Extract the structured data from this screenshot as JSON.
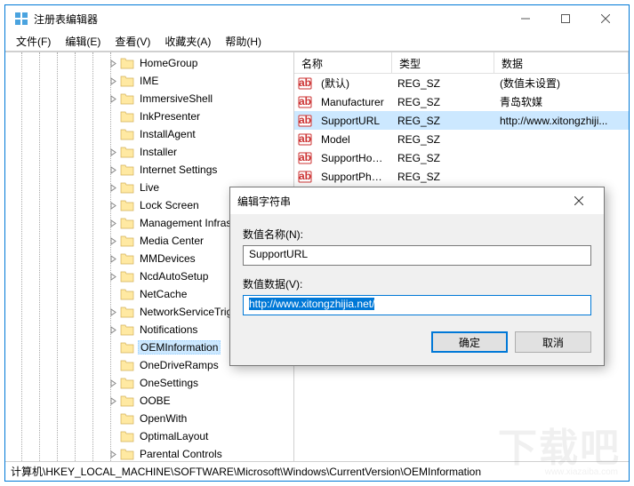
{
  "window": {
    "title": "注册表编辑器"
  },
  "menu": {
    "file": "文件(F)",
    "edit": "编辑(E)",
    "view": "查看(V)",
    "favorites": "收藏夹(A)",
    "help": "帮助(H)"
  },
  "tree": {
    "items": [
      {
        "label": "HomeGroup",
        "expandable": true
      },
      {
        "label": "IME",
        "expandable": true
      },
      {
        "label": "ImmersiveShell",
        "expandable": true
      },
      {
        "label": "InkPresenter",
        "expandable": false
      },
      {
        "label": "InstallAgent",
        "expandable": false
      },
      {
        "label": "Installer",
        "expandable": true
      },
      {
        "label": "Internet Settings",
        "expandable": true
      },
      {
        "label": "Live",
        "expandable": true
      },
      {
        "label": "Lock Screen",
        "expandable": true
      },
      {
        "label": "Management Infrastructure",
        "expandable": true
      },
      {
        "label": "Media Center",
        "expandable": true
      },
      {
        "label": "MMDevices",
        "expandable": true
      },
      {
        "label": "NcdAutoSetup",
        "expandable": true
      },
      {
        "label": "NetCache",
        "expandable": false
      },
      {
        "label": "NetworkServiceTriggers",
        "expandable": true
      },
      {
        "label": "Notifications",
        "expandable": true
      },
      {
        "label": "OEMInformation",
        "expandable": false,
        "selected": true
      },
      {
        "label": "OneDriveRamps",
        "expandable": false
      },
      {
        "label": "OneSettings",
        "expandable": true
      },
      {
        "label": "OOBE",
        "expandable": true
      },
      {
        "label": "OpenWith",
        "expandable": false
      },
      {
        "label": "OptimalLayout",
        "expandable": false
      },
      {
        "label": "Parental Controls",
        "expandable": true
      }
    ]
  },
  "list": {
    "headers": {
      "name": "名称",
      "type": "类型",
      "data": "数据"
    },
    "rows": [
      {
        "name": "(默认)",
        "type": "REG_SZ",
        "data": "(数值未设置)"
      },
      {
        "name": "Manufacturer",
        "type": "REG_SZ",
        "data": "青岛软媒"
      },
      {
        "name": "SupportURL",
        "type": "REG_SZ",
        "data": "http://www.xitongzhiji...",
        "selected": true
      },
      {
        "name": "Model",
        "type": "REG_SZ",
        "data": ""
      },
      {
        "name": "SupportHours",
        "type": "REG_SZ",
        "data": ""
      },
      {
        "name": "SupportPhone",
        "type": "REG_SZ",
        "data": ""
      }
    ]
  },
  "statusbar": {
    "path": "计算机\\HKEY_LOCAL_MACHINE\\SOFTWARE\\Microsoft\\Windows\\CurrentVersion\\OEMInformation"
  },
  "dialog": {
    "title": "编辑字符串",
    "name_label": "数值名称(N):",
    "name_value": "SupportURL",
    "data_label": "数值数据(V):",
    "data_value": "http://www.xitongzhijia.net/",
    "ok": "确定",
    "cancel": "取消"
  },
  "watermark": {
    "main": "下载吧",
    "sub": "www.xiazaiba.com"
  }
}
